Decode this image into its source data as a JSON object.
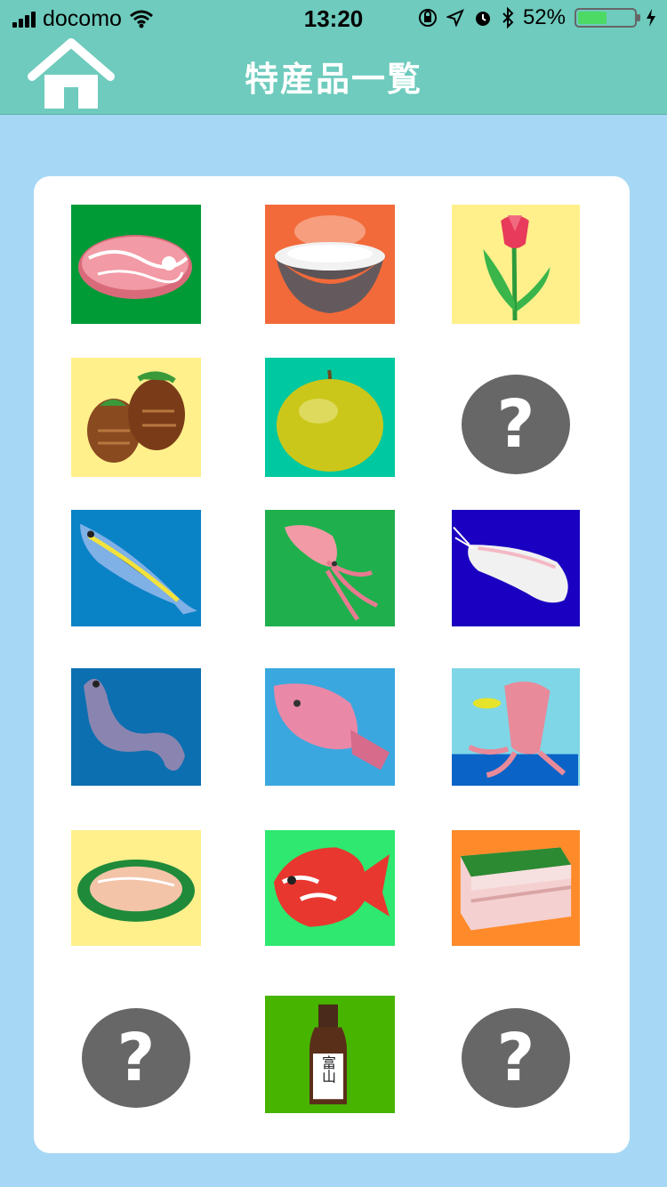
{
  "status_bar": {
    "carrier": "docomo",
    "time": "13:20",
    "battery_percent": "52%",
    "battery_level": 0.52
  },
  "nav": {
    "title": "特産品一覧",
    "home_icon": "home-icon"
  },
  "items": [
    {
      "kind": "image",
      "subject": "beef",
      "bg": "#009b37"
    },
    {
      "kind": "image",
      "subject": "rice",
      "bg": "#f26a3a"
    },
    {
      "kind": "image",
      "subject": "tulip",
      "bg": "#fff08c"
    },
    {
      "kind": "image",
      "subject": "taro",
      "bg": "#fff08c"
    },
    {
      "kind": "image",
      "subject": "pear",
      "bg": "#00c8a0"
    },
    {
      "kind": "unknown",
      "label": "?"
    },
    {
      "kind": "image",
      "subject": "yellowtail",
      "bg": "#0a82c6"
    },
    {
      "kind": "image",
      "subject": "squid",
      "bg": "#1fb04d"
    },
    {
      "kind": "image",
      "subject": "shrimp",
      "bg": "#1a00c0"
    },
    {
      "kind": "image",
      "subject": "eel",
      "bg": "#0b6fb0"
    },
    {
      "kind": "image",
      "subject": "flatfish",
      "bg": "#3aa8de"
    },
    {
      "kind": "image",
      "subject": "firefly-squid",
      "bg": "#7fd6e6"
    },
    {
      "kind": "image",
      "subject": "trout-sushi",
      "bg": "#fff08c"
    },
    {
      "kind": "image",
      "subject": "sea-bream",
      "bg": "#2ee86f"
    },
    {
      "kind": "image",
      "subject": "pressed-sushi",
      "bg": "#ff8a2a"
    },
    {
      "kind": "unknown",
      "label": "?"
    },
    {
      "kind": "image",
      "subject": "sake",
      "bg": "#47b400",
      "text": "富山"
    },
    {
      "kind": "unknown",
      "label": "?"
    }
  ]
}
